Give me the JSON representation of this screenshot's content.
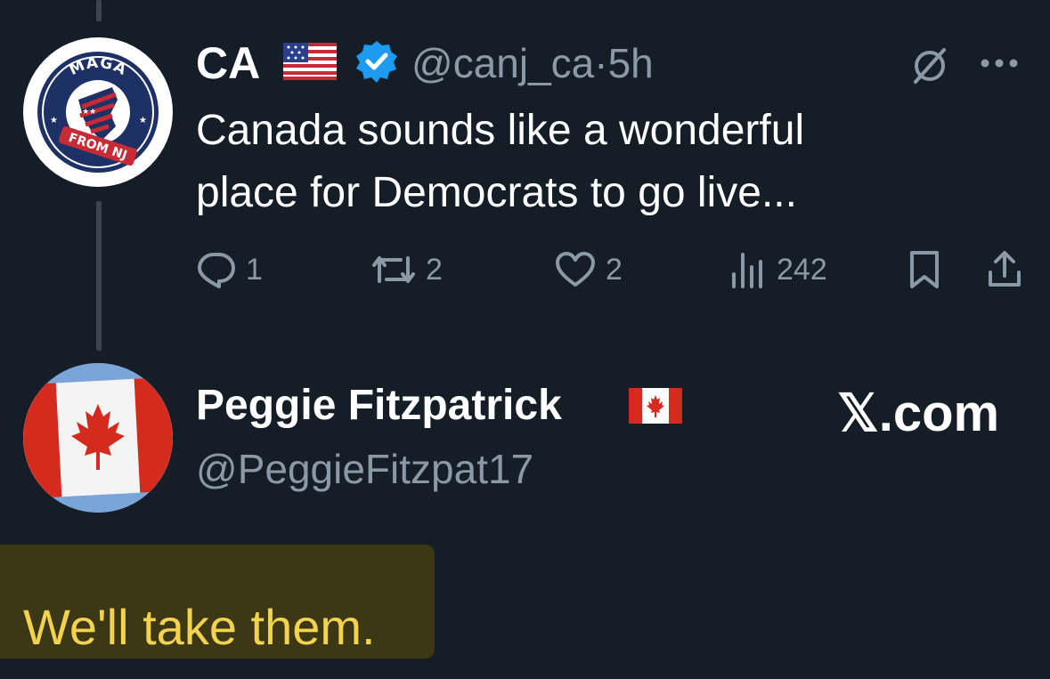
{
  "tweet": {
    "author_name": "CA",
    "author_flag_icon": "us-flag-icon",
    "verified_icon": "verified-badge-icon",
    "handle": "@canj_ca",
    "separator": "·",
    "time": "5h",
    "text_line1": "Canada sounds like a wonderful",
    "text_line2": "place for Democrats to go live...",
    "avatar_text_top": "MAGA",
    "avatar_text_bottom": "FROM NJ",
    "actions": {
      "replies": "1",
      "reposts": "2",
      "likes": "2",
      "views": "242"
    }
  },
  "reply": {
    "author_name": "Peggie Fitzpatrick",
    "author_flag_icon": "canada-flag-icon",
    "handle": "@PeggieFitzpat17",
    "brand": "𝕏.com",
    "text": "We'll take them."
  },
  "colors": {
    "background": "#151d27",
    "text_primary": "#ffffff",
    "text_secondary": "#8b98a5",
    "verified": "#1d9bf0",
    "highlight_bg": "#3c3715",
    "highlight_text": "#f3d24e"
  }
}
